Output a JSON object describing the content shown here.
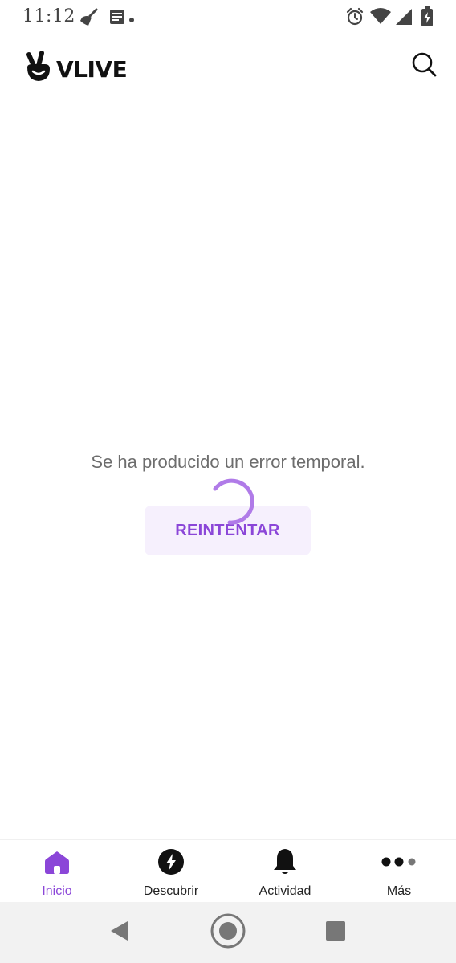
{
  "status_bar": {
    "time": "11:12",
    "left_icons": [
      "broom-icon",
      "notes-icon",
      "dot-icon"
    ],
    "right_icons": [
      "alarm-icon",
      "wifi-icon",
      "signal-icon",
      "battery-charging-icon"
    ]
  },
  "header": {
    "logo_text": "VLIVE",
    "logo_icon": "peace-hand-icon",
    "search_icon": "search-icon"
  },
  "main": {
    "error_message": "Se ha producido un error temporal.",
    "retry_label": "REINTENTAR",
    "spinner_icon": "loading-spinner-icon"
  },
  "bottom_nav": {
    "items": [
      {
        "label": "Inicio",
        "icon": "home-icon",
        "active": true
      },
      {
        "label": "Descubrir",
        "icon": "lightning-icon",
        "active": false
      },
      {
        "label": "Actividad",
        "icon": "bell-icon",
        "active": false
      },
      {
        "label": "Más",
        "icon": "more-dots-icon",
        "active": false
      }
    ]
  },
  "system_nav": {
    "buttons": [
      "back-icon",
      "home-circle-icon",
      "recents-icon"
    ]
  },
  "colors": {
    "accent": "#8b46d8",
    "button_bg": "#f6f0fd",
    "spinner": "#b07be8",
    "text_muted": "#6d6d6d"
  }
}
